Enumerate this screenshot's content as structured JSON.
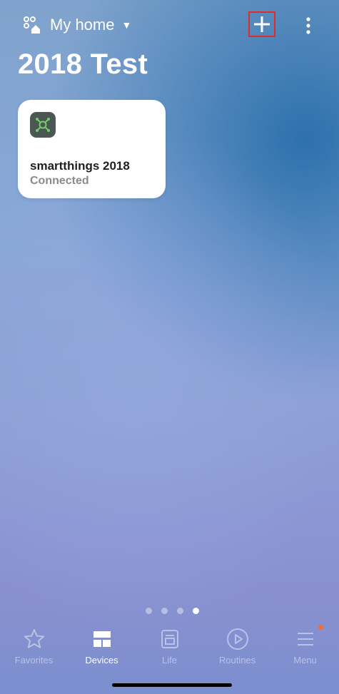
{
  "header": {
    "home_name": "My home",
    "add_icon": "plus-icon",
    "more_icon": "more-vertical-icon",
    "home_icon": "home-grid-icon"
  },
  "page": {
    "title": "2018 Test"
  },
  "devices": [
    {
      "name": "smartthings 2018",
      "status": "Connected",
      "icon": "hub-icon",
      "icon_bg": "#4a5752",
      "icon_accent": "#6fcf6a"
    }
  ],
  "pager": {
    "pages": 4,
    "active_page": 4
  },
  "tabs": [
    {
      "label": "Favorites",
      "icon": "star-icon",
      "active": false
    },
    {
      "label": "Devices",
      "icon": "devices-icon",
      "active": true
    },
    {
      "label": "Life",
      "icon": "life-icon",
      "active": false
    },
    {
      "label": "Routines",
      "icon": "play-circle-icon",
      "active": false
    },
    {
      "label": "Menu",
      "icon": "menu-icon",
      "active": false,
      "badge": true
    }
  ],
  "colors": {
    "highlight_border": "#e12a2a",
    "badge": "#f26c3a"
  }
}
